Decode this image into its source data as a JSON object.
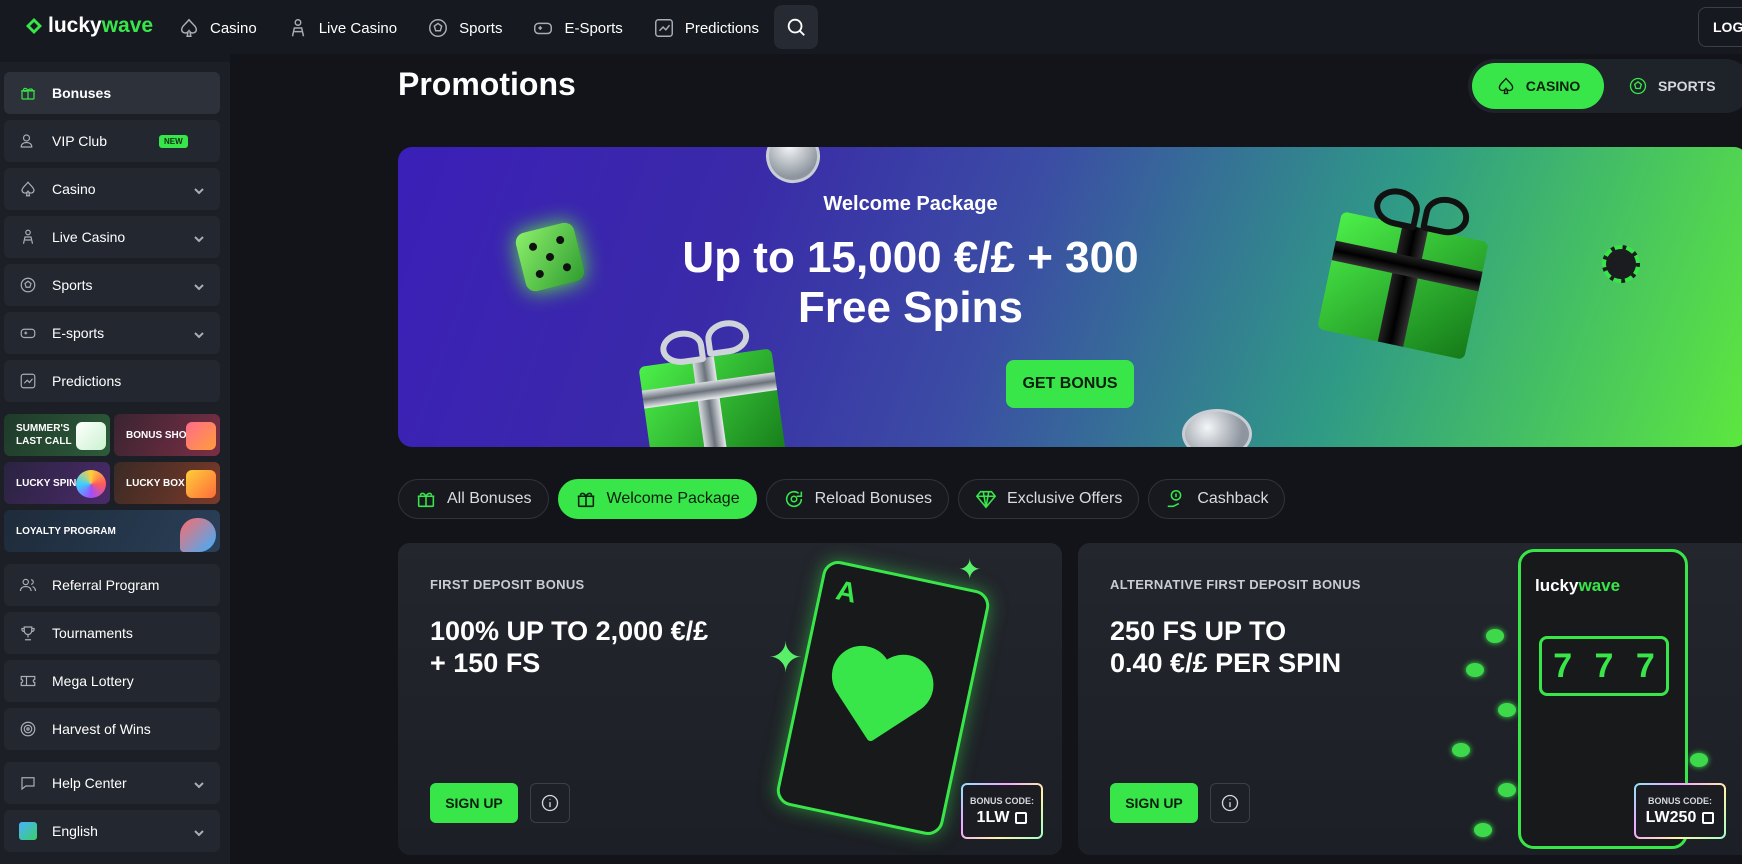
{
  "header": {
    "logo_part1": "lucky",
    "logo_part2": "wave",
    "nav": [
      {
        "label": "Casino",
        "icon": "spade-icon"
      },
      {
        "label": "Live Casino",
        "icon": "dealer-icon"
      },
      {
        "label": "Sports",
        "icon": "soccer-ball-icon"
      },
      {
        "label": "E-Sports",
        "icon": "gamepad-icon"
      },
      {
        "label": "Predictions",
        "icon": "trend-chart-icon"
      }
    ],
    "login_label": "LOG"
  },
  "sidebar": {
    "items": [
      {
        "label": "Bonuses",
        "icon": "gift-icon",
        "active": true
      },
      {
        "label": "VIP Club",
        "icon": "vip-user-icon",
        "badge": "NEW"
      },
      {
        "label": "Casino",
        "icon": "spade-icon"
      },
      {
        "label": "Live Casino",
        "icon": "dealer-icon"
      },
      {
        "label": "Sports",
        "icon": "soccer-ball-icon"
      },
      {
        "label": "E-sports",
        "icon": "gamepad-icon"
      },
      {
        "label": "Predictions",
        "icon": "trend-chart-icon"
      }
    ],
    "tiles": [
      {
        "label": "SUMMER'S LAST CALL"
      },
      {
        "label": "BONUS SHOP"
      },
      {
        "label": "LUCKY SPIN"
      },
      {
        "label": "LUCKY BOX"
      },
      {
        "label": "LOYALTY PROGRAM"
      }
    ],
    "items2": [
      {
        "label": "Referral Program",
        "icon": "users-icon"
      },
      {
        "label": "Tournaments",
        "icon": "trophy-icon"
      },
      {
        "label": "Mega Lottery",
        "icon": "ticket-icon"
      },
      {
        "label": "Harvest of Wins",
        "icon": "target-icon"
      }
    ],
    "help": {
      "label": "Help Center",
      "icon": "chat-icon"
    },
    "language": {
      "label": "English",
      "icon": "globe-icon"
    }
  },
  "page": {
    "title": "Promotions",
    "toggle": {
      "casino": "CASINO",
      "sports": "SPORTS"
    }
  },
  "hero": {
    "subtitle": "Welcome Package",
    "headline_line1": "Up to 15,000 €/£ + 300",
    "headline_line2": "Free Spins",
    "cta": "GET BONUS"
  },
  "filters": [
    {
      "label": "All Bonuses",
      "icon": "gift-icon"
    },
    {
      "label": "Welcome Package",
      "icon": "gift-open-icon",
      "active": true
    },
    {
      "label": "Reload Bonuses",
      "icon": "reload-icon"
    },
    {
      "label": "Exclusive Offers",
      "icon": "diamond-icon"
    },
    {
      "label": "Cashback",
      "icon": "cashback-icon"
    }
  ],
  "cards": [
    {
      "kicker": "FIRST DEPOSIT BONUS",
      "title_line1": "100% UP TO 2,000 €/£",
      "title_line2": "+ 150 FS",
      "signup": "SIGN UP",
      "code_label": "BONUS CODE:",
      "code_value": "1LW",
      "card_letter": "A"
    },
    {
      "kicker": "ALTERNATIVE FIRST DEPOSIT BONUS",
      "title_line1": "250 FS UP TO",
      "title_line2": "0.40 €/£ PER SPIN",
      "signup": "SIGN UP",
      "code_label": "BONUS CODE:",
      "code_value": "LW250",
      "slot_reels": [
        "7",
        "7",
        "7"
      ]
    }
  ],
  "colors": {
    "accent": "#39e64a",
    "background": "#121419",
    "sidebar": "#1c1f26"
  }
}
